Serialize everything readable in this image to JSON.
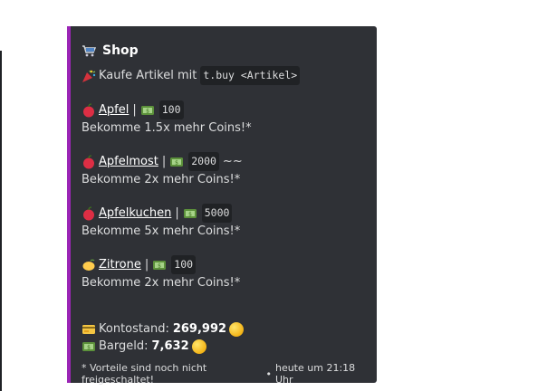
{
  "embed": {
    "title": "Shop",
    "intro_text": "Kaufe Artikel mit",
    "intro_code": "t.buy <Artikel>",
    "items": [
      {
        "name": "Apfel",
        "price": "100",
        "suffix": "",
        "desc": "Bekomme 1.5x mehr Coins!*",
        "icon": "apple-icon"
      },
      {
        "name": "Apfelmost",
        "price": "2000",
        "suffix": "~~",
        "desc": "Bekomme 2x mehr Coins!*",
        "icon": "apple-icon"
      },
      {
        "name": "Apfelkuchen",
        "price": "5000",
        "suffix": "",
        "desc": "Bekomme 5x mehr Coins!*",
        "icon": "apple-icon"
      },
      {
        "name": "Zitrone",
        "price": "100",
        "suffix": "",
        "desc": "Bekomme 2x mehr Coins!*",
        "icon": "lemon-icon"
      }
    ],
    "separator": "|",
    "balance_label": "Kontostand:",
    "balance_value": "269,992",
    "cash_label": "Bargeld:",
    "cash_value": "7,632",
    "footer_text": "* Vorteile sind noch nicht freigeschaltet!",
    "footer_sep": "•",
    "footer_time": "heute um 21:18 Uhr"
  },
  "colors": {
    "accent": "#9b26b6",
    "embed_bg": "#2f3136",
    "text": "#dcddde"
  }
}
